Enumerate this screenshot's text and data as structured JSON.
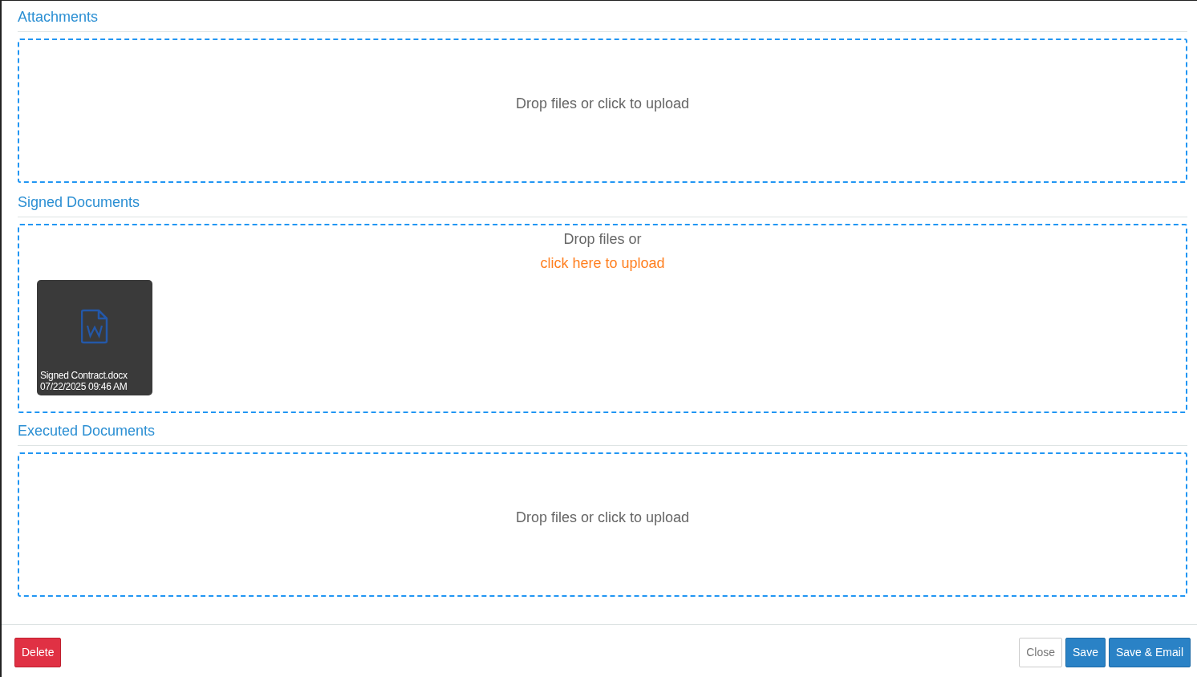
{
  "sections": [
    {
      "title": "Attachments",
      "dropzone": {
        "kind": "plain",
        "message": "Drop files or click to upload"
      }
    },
    {
      "title": "Signed Documents",
      "dropzone": {
        "kind": "link",
        "message": "Drop files or",
        "link": "click here to upload",
        "files": [
          {
            "name": "Signed Contract.docx",
            "date": "07/22/2025 09:46 AM"
          }
        ]
      }
    },
    {
      "title": "Executed Documents",
      "dropzone": {
        "kind": "plain",
        "message": "Drop files or click to upload"
      }
    }
  ],
  "footer": {
    "left": [
      {
        "label": "Delete",
        "kind": "danger"
      }
    ],
    "right": [
      {
        "label": "Close",
        "kind": "light"
      },
      {
        "label": "Save",
        "kind": "primary"
      },
      {
        "label": "Save & Email",
        "kind": "primary"
      }
    ]
  }
}
